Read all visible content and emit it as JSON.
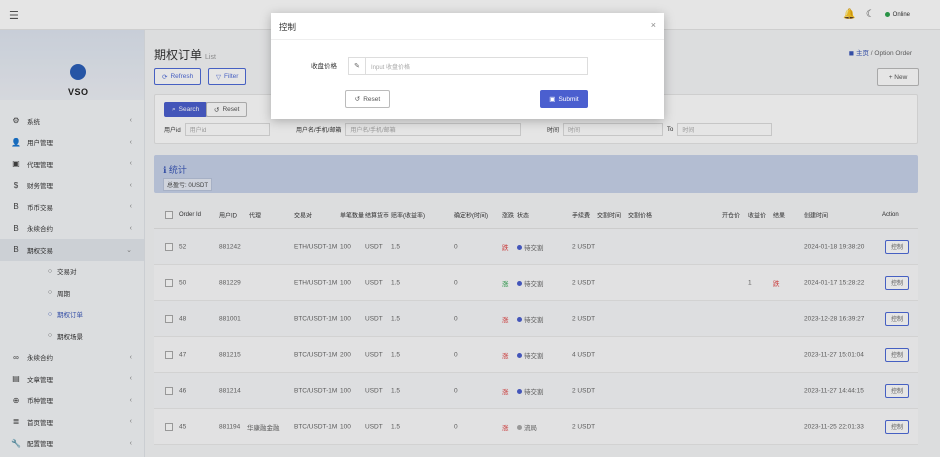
{
  "topbar": {
    "menu_icon": "☰",
    "bell_icon": "🔔",
    "moon_icon": "☾",
    "online_label": "Online"
  },
  "sidebar": {
    "logo": "VSO",
    "items": [
      {
        "icon": "gear-icon",
        "glyph": "⚙",
        "label": "系统"
      },
      {
        "icon": "user-icon",
        "glyph": "👤",
        "label": "用户管理"
      },
      {
        "icon": "agent-icon",
        "glyph": "▣",
        "label": "代理管理"
      },
      {
        "icon": "dollar-icon",
        "glyph": "$",
        "label": "财务管理"
      },
      {
        "icon": "coin-icon",
        "glyph": "B",
        "label": "币币交易"
      },
      {
        "icon": "coin-icon",
        "glyph": "B",
        "label": "永续合约"
      },
      {
        "icon": "coin-icon",
        "glyph": "B",
        "label": "期权交易"
      }
    ],
    "subitems": [
      "交易对",
      "周期",
      "期权订单",
      "期权场景"
    ],
    "items2": [
      {
        "icon": "link-icon",
        "glyph": "∞",
        "label": "永续合约"
      },
      {
        "icon": "article-icon",
        "glyph": "▤",
        "label": "文章管理"
      },
      {
        "icon": "plus-icon",
        "glyph": "⊕",
        "label": "币种管理"
      },
      {
        "icon": "list-icon",
        "glyph": "≣",
        "label": "首页管理"
      },
      {
        "icon": "wrench-icon",
        "glyph": "🔧",
        "label": "配置管理"
      },
      {
        "icon": "risk-icon",
        "glyph": "▦",
        "label": "风控管理"
      }
    ]
  },
  "page": {
    "title": "期权订单",
    "subtitle": "List",
    "breadcrumb_home": "主页",
    "breadcrumb_sep": "/",
    "breadcrumb_current": "Option Order",
    "refresh_label": "Refresh",
    "filter_label": "Filter",
    "new_label": "+ New"
  },
  "search": {
    "search_label": "Search",
    "reset_label": "Reset",
    "user_id_label": "用户id",
    "user_id_placeholder": "用户id",
    "user_name_label": "用户名/手机/邮箱",
    "user_name_placeholder": "用户名/手机/邮箱",
    "time_label": "时间",
    "time_from_placeholder": "时间",
    "time_to_placeholder": "时间",
    "time_to_sep": "To"
  },
  "stats": {
    "title": "统计",
    "text": "总盈亏: 0USDT"
  },
  "table": {
    "headers": [
      "Order Id",
      "用户ID",
      "代理",
      "交易对",
      "单笔数量",
      "结算货币",
      "赔率(收益率)",
      "确定秒(时间)",
      "涨跌",
      "状态",
      "手续费",
      "交割时间",
      "交割价格",
      "开仓价",
      "收益价",
      "结果",
      "创建时间",
      "Action"
    ],
    "rows": [
      {
        "id": "52",
        "uid": "881242",
        "agent": "",
        "pair": "ETH/USDT-1M",
        "qty": "100",
        "currency": "USDT",
        "odds": "1.5",
        "sec": "0",
        "dir": "跌",
        "dir_color": "red",
        "status": "待交割",
        "status_dot": "purple",
        "fee": "2 USDT",
        "open": "",
        "close": "",
        "result": "",
        "created": "2024-01-18 19:38:20",
        "action": "控制"
      },
      {
        "id": "50",
        "uid": "881229",
        "agent": "",
        "pair": "ETH/USDT-1M",
        "qty": "100",
        "currency": "USDT",
        "odds": "1.5",
        "sec": "0",
        "dir": "涨",
        "dir_color": "green",
        "status": "待交割",
        "status_dot": "purple",
        "fee": "2 USDT",
        "open": "",
        "close": "1",
        "result": "跌",
        "created": "2024-01-17 15:28:22",
        "action": "控制"
      },
      {
        "id": "48",
        "uid": "881001",
        "agent": "",
        "pair": "BTC/USDT-1M",
        "qty": "100",
        "currency": "USDT",
        "odds": "1.5",
        "sec": "0",
        "dir": "涨",
        "dir_color": "red",
        "status": "待交割",
        "status_dot": "purple",
        "fee": "2 USDT",
        "open": "",
        "close": "",
        "result": "",
        "created": "2023-12-28 16:39:27",
        "action": "控制"
      },
      {
        "id": "47",
        "uid": "881215",
        "agent": "",
        "pair": "BTC/USDT-1M",
        "qty": "200",
        "currency": "USDT",
        "odds": "1.5",
        "sec": "0",
        "dir": "涨",
        "dir_color": "red",
        "status": "待交割",
        "status_dot": "purple",
        "fee": "4 USDT",
        "open": "",
        "close": "",
        "result": "",
        "created": "2023-11-27 15:01:04",
        "action": "控制"
      },
      {
        "id": "46",
        "uid": "881214",
        "agent": "",
        "pair": "BTC/USDT-1M",
        "qty": "100",
        "currency": "USDT",
        "odds": "1.5",
        "sec": "0",
        "dir": "涨",
        "dir_color": "red",
        "status": "待交割",
        "status_dot": "purple",
        "fee": "2 USDT",
        "open": "",
        "close": "",
        "result": "",
        "created": "2023-11-27 14:44:15",
        "action": "控制"
      },
      {
        "id": "45",
        "uid": "881194",
        "agent": "华康融金融",
        "pair": "BTC/USDT-1M",
        "qty": "100",
        "currency": "USDT",
        "odds": "1.5",
        "sec": "0",
        "dir": "涨",
        "dir_color": "red",
        "status": "流局",
        "status_dot": "gray",
        "fee": "2 USDT",
        "open": "",
        "close": "",
        "result": "",
        "created": "2023-11-25 22:01:33",
        "action": "控制"
      }
    ]
  },
  "modal": {
    "title": "控制",
    "close_glyph": "×",
    "field_label": "收盘价格",
    "field_placeholder": "Input 收盘价格",
    "reset_label": "Reset",
    "submit_label": "Submit"
  }
}
